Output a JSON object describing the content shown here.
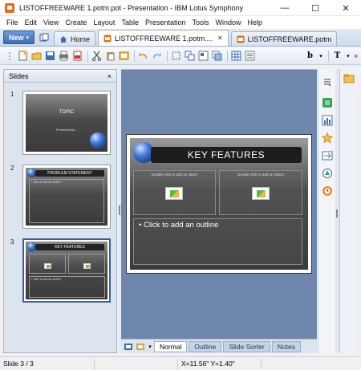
{
  "window": {
    "title": "LISTOFFREEWARE 1.potm.pot - Presentation - IBM Lotus Symphony",
    "minimize": "—",
    "maximize": "☐",
    "close": "✕"
  },
  "menu": [
    "File",
    "Edit",
    "View",
    "Create",
    "Layout",
    "Table",
    "Presentation",
    "Tools",
    "Window",
    "Help"
  ],
  "tabs": {
    "new_label": "New",
    "home": "Home",
    "doc1": "LISTOFFREEWARE 1.potm....",
    "doc2": "LISTOFFREEWARE.potm"
  },
  "slides_panel": {
    "title": "Slides",
    "close": "×",
    "slides": [
      {
        "num": "1",
        "title": "TOPIC",
        "subtitle": "Presented by..."
      },
      {
        "num": "2",
        "title": "PROBLEM STATEMENT",
        "outline": "• Click to add an outline"
      },
      {
        "num": "3",
        "title": "KEY FEATURES",
        "outline": "• Click to add an outline",
        "box_label": "Double-click to add an object"
      }
    ]
  },
  "current_slide": {
    "title": "KEY FEATURES",
    "box_left_label": "Double-click to add an object",
    "box_right_label": "Double-click to add an object",
    "outline": "• Click to add an outline"
  },
  "view_tabs": [
    "Normal",
    "Outline",
    "Slide Sorter",
    "Notes"
  ],
  "status": {
    "slide": "Slide 3 / 3",
    "coords": "X=11.56\" Y=1.40\""
  },
  "colors": {
    "accent": "#3e6fb5",
    "workspace": "#6f86ad"
  }
}
